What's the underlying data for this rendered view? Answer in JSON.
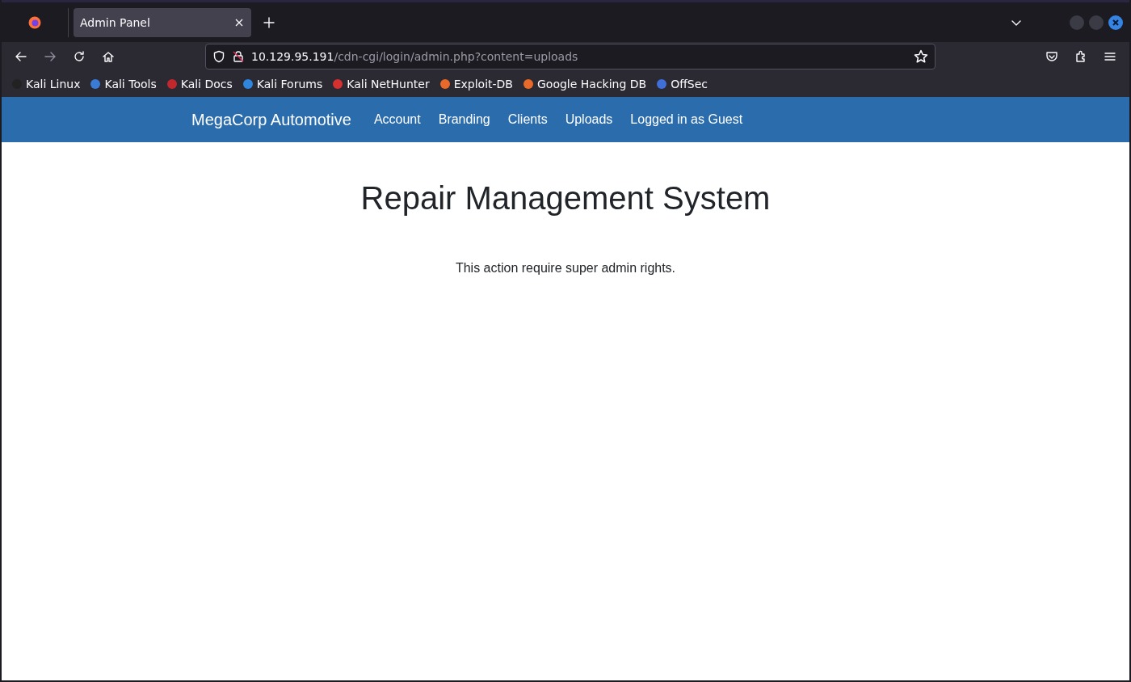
{
  "browser": {
    "tabs": [
      {
        "title": "Admin Panel",
        "selected": true
      }
    ],
    "address_bar": {
      "host": "10.129.95.191",
      "path": "/cdn-cgi/login/admin.php?content=uploads"
    },
    "bookmarks": [
      {
        "label": "Kali Linux",
        "color": "#222222"
      },
      {
        "label": "Kali Tools",
        "color": "#3a7bd5"
      },
      {
        "label": "Kali Docs",
        "color": "#c0282d"
      },
      {
        "label": "Kali Forums",
        "color": "#2e86de"
      },
      {
        "label": "Kali NetHunter",
        "color": "#d63031"
      },
      {
        "label": "Exploit-DB",
        "color": "#e8692a"
      },
      {
        "label": "Google Hacking DB",
        "color": "#e8692a"
      },
      {
        "label": "OffSec",
        "color": "#3f6fd8"
      }
    ]
  },
  "navbar": {
    "brand": "MegaCorp Automotive",
    "links": [
      "Account",
      "Branding",
      "Clients",
      "Uploads",
      "Logged in as Guest"
    ]
  },
  "page": {
    "heading": "Repair Management System",
    "message": "This action require super admin rights."
  }
}
